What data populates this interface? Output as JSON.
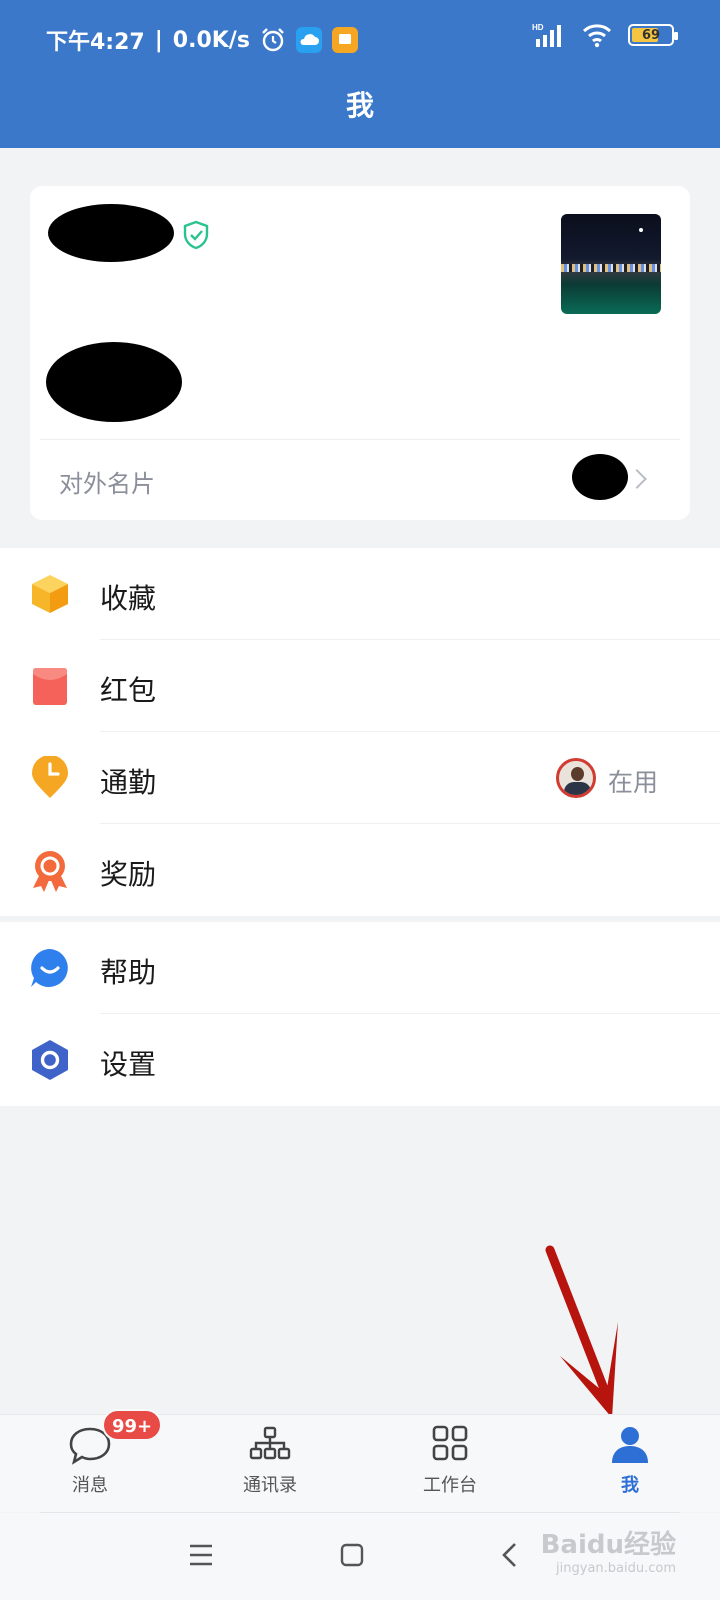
{
  "status_bar": {
    "time": "下午4:27",
    "speed": "0.0K/s",
    "signal_label": "HD",
    "battery": "69",
    "battery_level": 0.69,
    "icons": [
      "alarm-icon",
      "cloud-icon",
      "message-app-icon",
      "signal-icon",
      "wifi-icon",
      "battery-icon"
    ]
  },
  "header": {
    "title": "我"
  },
  "profile": {
    "name_redacted": true,
    "verified_icon": "shield-check-icon",
    "photo": "night-city-photo",
    "external_card_label": "对外名片"
  },
  "menu_group_1": [
    {
      "label": "收藏",
      "icon": "favorite-box-icon",
      "color": "#f5b82e"
    },
    {
      "label": "红包",
      "icon": "red-envelope-icon",
      "color": "#f4625a"
    },
    {
      "label": "通勤",
      "icon": "commute-clock-icon",
      "color": "#f5a623",
      "status": "在用"
    },
    {
      "label": "奖励",
      "icon": "reward-medal-icon",
      "color": "#f26a3d"
    }
  ],
  "menu_group_2": [
    {
      "label": "帮助",
      "icon": "help-chat-icon",
      "color": "#2f80ed"
    },
    {
      "label": "设置",
      "icon": "settings-hexagon-icon",
      "color": "#3f63c8"
    }
  ],
  "tabbar": {
    "tabs": [
      {
        "label": "消息",
        "icon": "chat-bubble-icon",
        "badge": "99+"
      },
      {
        "label": "通讯录",
        "icon": "org-chart-icon"
      },
      {
        "label": "工作台",
        "icon": "grid-apps-icon"
      },
      {
        "label": "我",
        "icon": "person-icon",
        "active": true
      }
    ]
  },
  "watermark": {
    "brand": "Baidu经验",
    "url": "jingyan.baidu.com"
  },
  "colors": {
    "header": "#3b78c9",
    "active_tab": "#2e6fd6",
    "badge": "#e84a45",
    "annotation_arrow": "#b8140e"
  }
}
